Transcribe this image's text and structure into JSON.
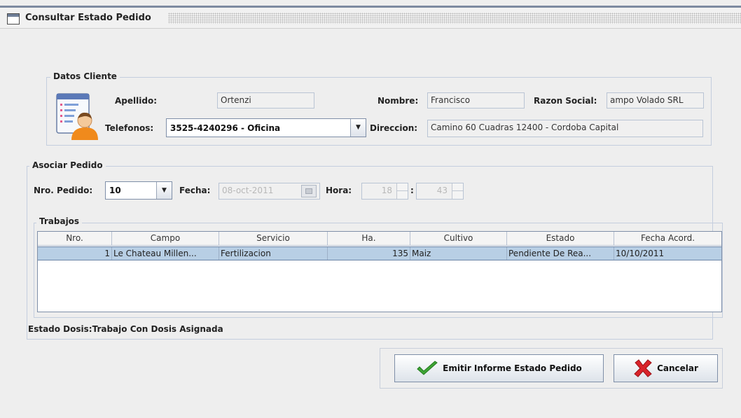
{
  "window": {
    "title": "Consultar Estado Pedido"
  },
  "datos_cliente": {
    "title": "Datos Cliente",
    "apellido_label": "Apellido:",
    "apellido_value": "Ortenzi",
    "nombre_label": "Nombre:",
    "nombre_value": "Francisco",
    "razon_social_label": "Razon Social:",
    "razon_social_value": "ampo Volado SRL",
    "telefonos_label": "Telefonos:",
    "telefonos_value": "3525-4240296 - Oficina",
    "direccion_label": "Direccion:",
    "direccion_value": "Camino 60 Cuadras 12400 - Cordoba Capital"
  },
  "asociar_pedido": {
    "title": "Asociar Pedido",
    "nro_pedido_label": "Nro. Pedido:",
    "nro_pedido_value": "10",
    "fecha_label": "Fecha:",
    "fecha_value": "08-oct-2011",
    "hora_label": "Hora:",
    "hora_value": "18",
    "hora_sep": ":",
    "minuto_value": "43"
  },
  "trabajos": {
    "title": "Trabajos",
    "columns": [
      "Nro.",
      "Campo",
      "Servicio",
      "Ha.",
      "Cultivo",
      "Estado",
      "Fecha Acord."
    ],
    "rows": [
      [
        "1",
        "Le Chateau Millen...",
        "Fertilizacion",
        "135",
        "Maiz",
        "Pendiente De Rea...",
        "10/10/2011"
      ]
    ]
  },
  "estado_dosis": "Estado Dosis:Trabajo Con Dosis Asignada",
  "actions": {
    "emitir_label": "Emitir Informe Estado Pedido",
    "cancelar_label": "Cancelar"
  },
  "colors": {
    "selection": "#b8cfe5",
    "check_icon": "#3fa535",
    "cancel_icon": "#d9232a"
  }
}
